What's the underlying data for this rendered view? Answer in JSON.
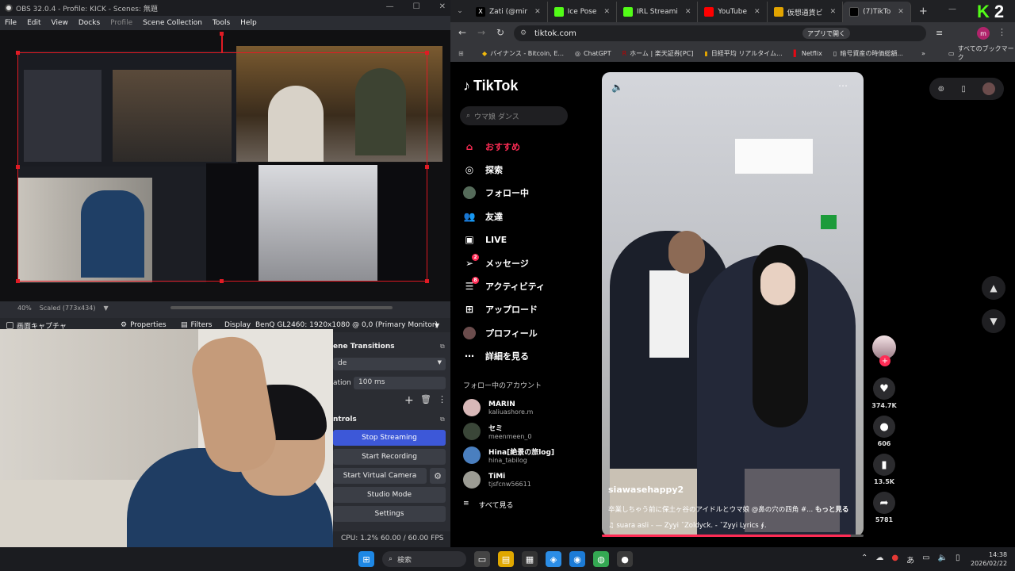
{
  "obs": {
    "title": "OBS 32.0.4 - Profile: KICK - Scenes: 無題",
    "menu": [
      "File",
      "Edit",
      "View",
      "Docks",
      "Profile",
      "Scene Collection",
      "Tools",
      "Help"
    ],
    "zoom": "40%",
    "scaled": "Scaled (773x434)",
    "source_name": "画面キャプチャ",
    "properties": "Properties",
    "filters": "Filters",
    "display_label": "Display",
    "display_value": "BenQ GL2460: 1920x1080 @ 0,0 (Primary Monitor)",
    "scene_transitions": "ene Transitions",
    "transition_value": "de",
    "duration_label": "ation",
    "duration_value": "100 ms",
    "controls_title": "ntrols",
    "controls": [
      "Stop Streaming",
      "Start Recording",
      "Start Virtual Camera",
      "Studio Mode",
      "Settings"
    ],
    "status_cpu": "CPU: 1.2%",
    "status_fps": "60.00 / 60.00 FPS",
    "dock_left_label": "Se"
  },
  "chrome": {
    "tabs": [
      {
        "label": "Zati (@mir",
        "favicon": "x-icon",
        "color": "#000000"
      },
      {
        "label": "Ice Pose",
        "favicon": "kick-icon",
        "color": "#53fc18"
      },
      {
        "label": "IRL Streami",
        "favicon": "kick-icon",
        "color": "#53fc18"
      },
      {
        "label": "YouTube",
        "favicon": "youtube-icon",
        "color": "#ff0000"
      },
      {
        "label": "仮想通貨ビ",
        "favicon": "note-icon",
        "color": "#e2a400"
      },
      {
        "label": "(7)TikTo",
        "favicon": "tiktok-icon",
        "color": "#000000"
      }
    ],
    "url": "tiktok.com",
    "app_chip": "アプリで開く",
    "bookmarks": [
      "バイナンス - Bitcoin, E...",
      "ChatGPT",
      "ホーム | 楽天証券[PC]",
      "日経平均 リアルタイム...",
      "Netflix",
      "暗号資産の時価総額..."
    ],
    "all_bookmarks": "すべてのブックマーク"
  },
  "tiktok": {
    "logo": "TikTok",
    "search_placeholder": "ウマ娘 ダンス",
    "nav": [
      {
        "label": "おすすめ",
        "icon": "home-icon",
        "active": true
      },
      {
        "label": "探索",
        "icon": "compass-icon"
      },
      {
        "label": "フォロー中",
        "icon": "avatar-icon"
      },
      {
        "label": "友達",
        "icon": "friends-icon"
      },
      {
        "label": "LIVE",
        "icon": "live-icon"
      },
      {
        "label": "メッセージ",
        "icon": "send-icon",
        "badge": "2"
      },
      {
        "label": "アクティビティ",
        "icon": "activity-icon",
        "badge": "8"
      },
      {
        "label": "アップロード",
        "icon": "upload-icon"
      },
      {
        "label": "プロフィール",
        "icon": "profile-icon"
      },
      {
        "label": "詳細を見る",
        "icon": "more-icon"
      }
    ],
    "following_header": "フォロー中のアカウント",
    "accounts": [
      {
        "name": "MARIN",
        "handle": "kaliuashore.m"
      },
      {
        "name": "セミ",
        "handle": "meenmeen_0"
      },
      {
        "name": "Hina[絶景の旅log]",
        "handle": "hina_tabilog"
      },
      {
        "name": "TiMi",
        "handle": "tjsfcnw56611"
      }
    ],
    "see_all": "すべて見る",
    "video": {
      "username": "siawasehappy2",
      "description": "卒業しちゃう前に保土ヶ谷のアイドルとウマ娘",
      "description_tag": "@鼻の穴の四角 #...",
      "more": "もっと見る",
      "music": "suara asli - — Zyyi ˇZoldyck. - ˇZyyi Lyrics ∮.",
      "progress": 0.95
    },
    "likes": "374.7K",
    "comments": "606",
    "saves": "13.5K",
    "shares": "5781"
  },
  "overlay": {
    "kick": "K",
    "number": "2"
  },
  "taskbar": {
    "search": "検索",
    "time": "14:38",
    "date": "2026/02/22",
    "ime": "あ"
  }
}
